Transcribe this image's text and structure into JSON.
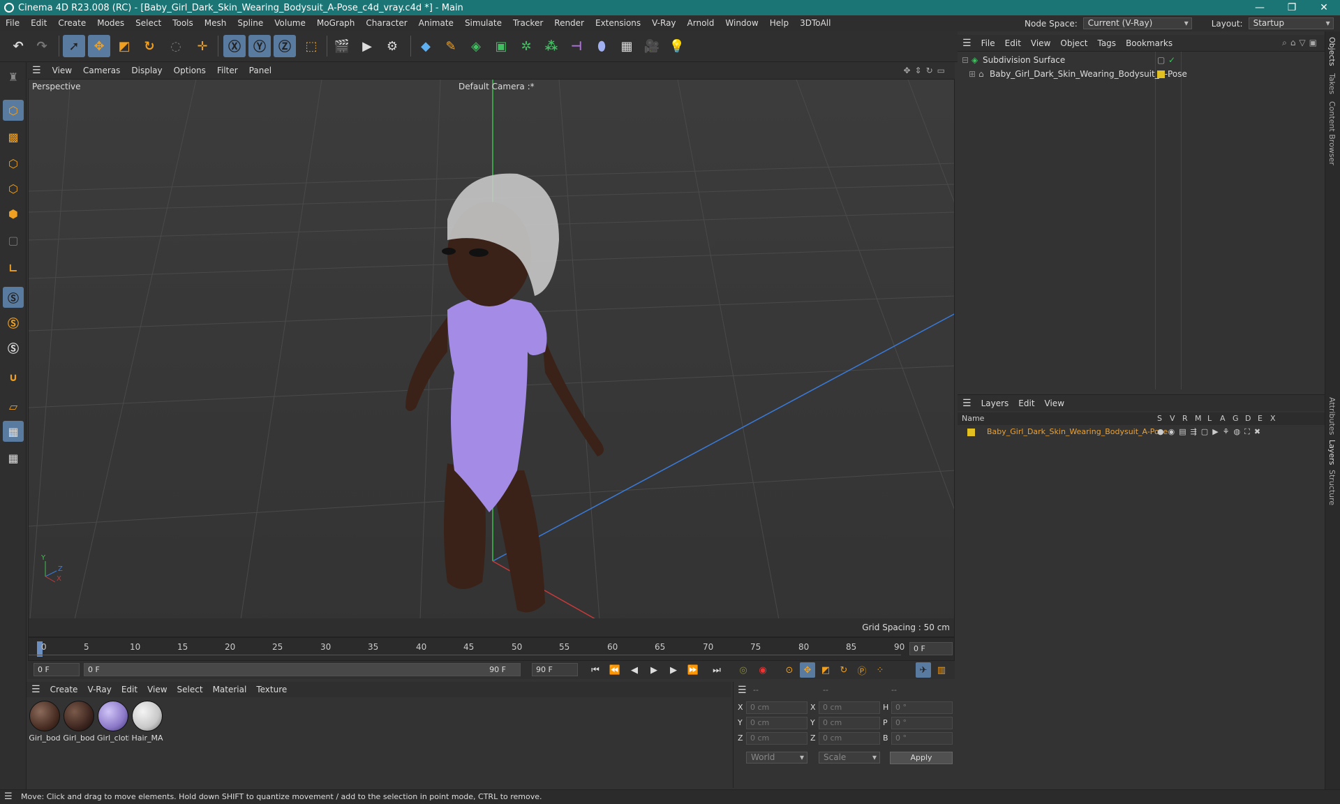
{
  "window": {
    "title": "Cinema 4D R23.008 (RC) - [Baby_Girl_Dark_Skin_Wearing_Bodysuit_A-Pose_c4d_vray.c4d *] - Main",
    "controls": [
      "—",
      "❐",
      "✕"
    ]
  },
  "menu": [
    "File",
    "Edit",
    "Create",
    "Modes",
    "Select",
    "Tools",
    "Mesh",
    "Spline",
    "Volume",
    "MoGraph",
    "Character",
    "Animate",
    "Simulate",
    "Tracker",
    "Render",
    "Extensions",
    "V-Ray",
    "Arnold",
    "Window",
    "Help",
    "3DToAll"
  ],
  "node_space": {
    "label": "Node Space:",
    "value": "Current (V-Ray)"
  },
  "layout": {
    "label": "Layout:",
    "value": "Startup"
  },
  "viewport_menu": [
    "View",
    "Cameras",
    "Display",
    "Options",
    "Filter",
    "Panel"
  ],
  "viewport": {
    "label": "Perspective",
    "camera": "Default Camera :*",
    "grid_spacing": "Grid Spacing : 50 cm",
    "axis_x": "X",
    "axis_y": "Y",
    "axis_z": "Z"
  },
  "timeline": {
    "ticks": [
      "0",
      "5",
      "10",
      "15",
      "20",
      "25",
      "30",
      "35",
      "40",
      "45",
      "50",
      "55",
      "60",
      "65",
      "70",
      "75",
      "80",
      "85",
      "90"
    ],
    "current_frame": "0 F",
    "start": "0 F",
    "range_start": "0 F",
    "range_end": "90 F",
    "end": "90 F"
  },
  "material_menu": [
    "Create",
    "V-Ray",
    "Edit",
    "View",
    "Select",
    "Material",
    "Texture"
  ],
  "materials": [
    {
      "name": "Girl_bod",
      "color": "#4a2e24"
    },
    {
      "name": "Girl_bod",
      "color": "#3e2620"
    },
    {
      "name": "Girl_clotl",
      "color": "#8b78c8"
    },
    {
      "name": "Hair_MA",
      "color": "#c8c8c8"
    }
  ],
  "coords": {
    "headers": [
      "--",
      "--",
      "--"
    ],
    "rows": [
      {
        "l1": "X",
        "v1": "0 cm",
        "l2": "X",
        "v2": "0 cm",
        "l3": "H",
        "v3": "0 °"
      },
      {
        "l1": "Y",
        "v1": "0 cm",
        "l2": "Y",
        "v2": "0 cm",
        "l3": "P",
        "v3": "0 °"
      },
      {
        "l1": "Z",
        "v1": "0 cm",
        "l2": "Z",
        "v2": "0 cm",
        "l3": "B",
        "v3": "0 °"
      }
    ],
    "mode1": "World",
    "mode2": "Scale",
    "apply": "Apply"
  },
  "object_menu": [
    "File",
    "Edit",
    "View",
    "Object",
    "Tags",
    "Bookmarks"
  ],
  "objects": [
    {
      "name": "Subdivision Surface"
    },
    {
      "name": "Baby_Girl_Dark_Skin_Wearing_Bodysuit_A-Pose"
    }
  ],
  "layers_menu": [
    "Layers",
    "Edit",
    "View"
  ],
  "layers_header": {
    "name": "Name",
    "cols": [
      "S",
      "V",
      "R",
      "M",
      "L",
      "A",
      "G",
      "D",
      "E",
      "X"
    ]
  },
  "layers": [
    {
      "name": "Baby_Girl_Dark_Skin_Wearing_Bodysuit_A-Pose",
      "color": "#e3c021"
    }
  ],
  "right_tabs": [
    "Objects",
    "Takes",
    "Content Browser",
    "Attributes",
    "Layers",
    "Structure"
  ],
  "status": "Move: Click and drag to move elements. Hold down SHIFT to quantize movement / add to the selection in point mode, CTRL to remove.",
  "colors": {
    "accent": "#1b7575",
    "selected": "#5a7ba0",
    "layer_text": "#e8a33a"
  }
}
